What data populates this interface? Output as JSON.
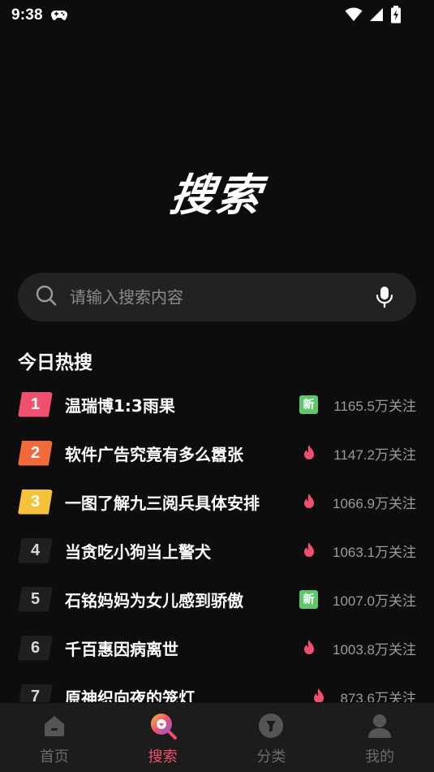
{
  "status_bar": {
    "time": "9:38",
    "icons": [
      "gamepad-icon",
      "wifi-icon",
      "signal-icon",
      "battery-charging-icon"
    ]
  },
  "hero": {
    "title": "搜索"
  },
  "search": {
    "placeholder": "请输入搜索内容",
    "value": "",
    "icon": "search-icon",
    "voice_icon": "microphone-icon"
  },
  "hot_section": {
    "title": "今日热搜"
  },
  "hot_list": [
    {
      "rank": "1",
      "title": "温瑞博1:3雨果",
      "tag": "新",
      "tag_type": "new",
      "count": "1165.5万关注"
    },
    {
      "rank": "2",
      "title": "软件广告究竟有多么嚣张",
      "tag": "",
      "tag_type": "hot",
      "count": "1147.2万关注"
    },
    {
      "rank": "3",
      "title": "一图了解九三阅兵具体安排",
      "tag": "",
      "tag_type": "hot",
      "count": "1066.9万关注"
    },
    {
      "rank": "4",
      "title": "当贪吃小狗当上警犬",
      "tag": "",
      "tag_type": "hot",
      "count": "1063.1万关注"
    },
    {
      "rank": "5",
      "title": "石铭妈妈为女儿感到骄傲",
      "tag": "新",
      "tag_type": "new",
      "count": "1007.0万关注"
    },
    {
      "rank": "6",
      "title": "千百惠因病离世",
      "tag": "",
      "tag_type": "hot",
      "count": "1003.8万关注"
    },
    {
      "rank": "7",
      "title": "原神织向夜的笼灯",
      "tag": "",
      "tag_type": "hot",
      "count": "873.6万关注"
    }
  ],
  "bottom_nav": [
    {
      "label": "首页",
      "icon": "home-icon",
      "active": false
    },
    {
      "label": "搜索",
      "icon": "search-nav-icon",
      "active": true
    },
    {
      "label": "分类",
      "icon": "category-icon",
      "active": false
    },
    {
      "label": "我的",
      "icon": "profile-icon",
      "active": false
    }
  ],
  "colors": {
    "background": "#0d0d0d",
    "search_bg": "#222222",
    "accent": "#f0506e",
    "rank1": "#f0506e",
    "rank2": "#f26a3c",
    "rank3": "#f5c33b",
    "new_tag": "#5cc86a",
    "hot_icon": "#f0506e",
    "nav_bg": "#1c1c1c"
  }
}
